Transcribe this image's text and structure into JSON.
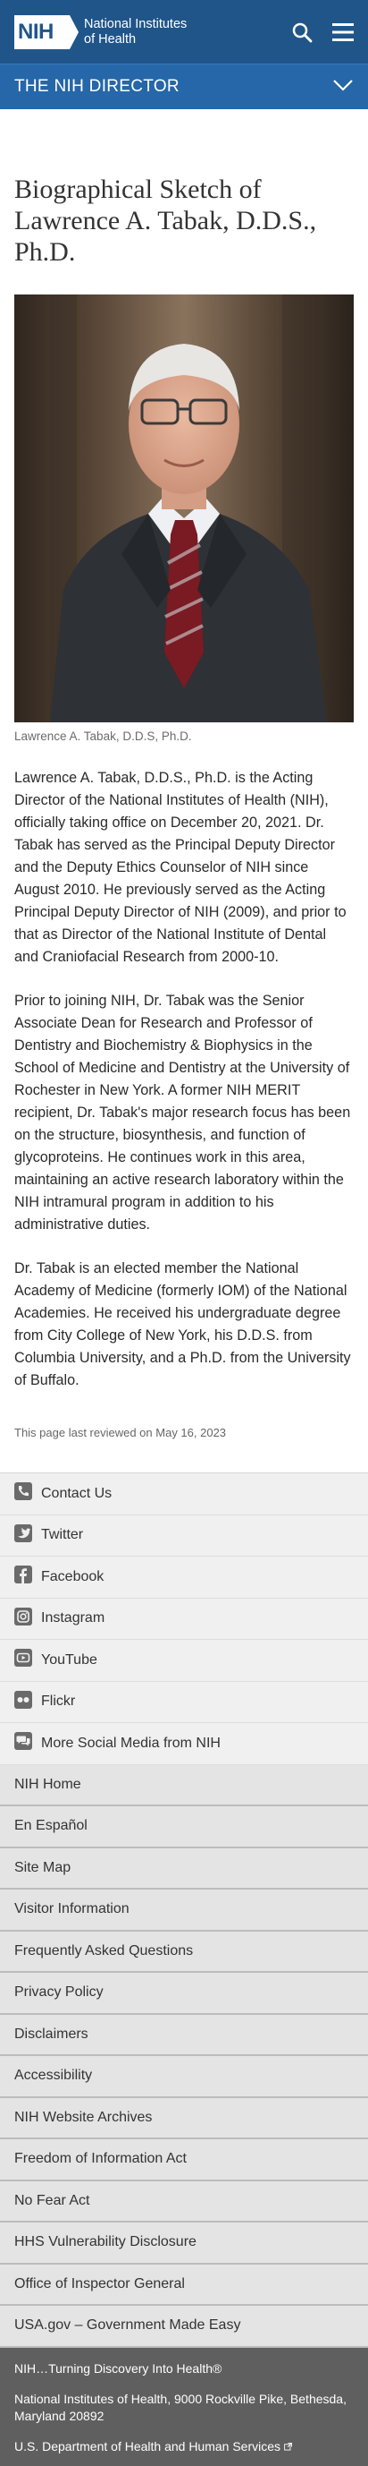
{
  "header": {
    "logo_mark": "NIH",
    "logo_line1": "National Institutes",
    "logo_line2": "of Health",
    "search_icon": "search-icon",
    "menu_icon": "hamburger-menu-icon"
  },
  "section_bar": {
    "title": "THE NIH DIRECTOR",
    "toggle_icon": "chevron-down-icon"
  },
  "article": {
    "title": "Biographical Sketch of Lawrence A. Tabak, D.D.S., Ph.D.",
    "image_caption": "Lawrence A. Tabak, D.D.S, Ph.D.",
    "paragraphs": [
      "Lawrence A. Tabak, D.D.S., Ph.D. is the Acting Director of the National Institutes of Health (NIH), officially taking office on December 20, 2021. Dr. Tabak has served as the Principal Deputy Director and the Deputy Ethics Counselor of NIH since August 2010. He previously served as the Acting Principal Deputy Director of NIH (2009), and prior to that as Director of the National Institute of Dental and Craniofacial Research from 2000-10.",
      "Prior to joining NIH, Dr. Tabak was the Senior Associate Dean for Research and Professor of Dentistry and Biochemistry & Biophysics in the School of Medicine and Dentistry at the University of Rochester in New York. A former NIH MERIT recipient, Dr. Tabak's major research focus has been on the structure, biosynthesis, and function of glycoproteins. He continues work in this area, maintaining an active research laboratory within the NIH intramural program in addition to his administrative duties.",
      "Dr. Tabak is an elected member the National Academy of Medicine (formerly IOM) of the National Academies. He received his undergraduate degree from City College of New York, his D.D.S. from Columbia University, and a Ph.D. from the University of Buffalo."
    ],
    "last_reviewed": "This page last reviewed on May 16, 2023"
  },
  "social": [
    {
      "label": "Contact Us",
      "icon": "phone-icon"
    },
    {
      "label": "Twitter",
      "icon": "twitter-icon"
    },
    {
      "label": "Facebook",
      "icon": "facebook-icon"
    },
    {
      "label": "Instagram",
      "icon": "instagram-icon"
    },
    {
      "label": "YouTube",
      "icon": "youtube-icon"
    },
    {
      "label": "Flickr",
      "icon": "flickr-icon"
    },
    {
      "label": "More Social Media from NIH",
      "icon": "chat-bubbles-icon"
    }
  ],
  "footer_links": [
    "NIH Home",
    "En Español",
    "Site Map",
    "Visitor Information",
    "Frequently Asked Questions",
    "Privacy Policy",
    "Disclaimers",
    "Accessibility",
    "NIH Website Archives",
    "Freedom of Information Act",
    "No Fear Act",
    "HHS Vulnerability Disclosure",
    "Office of Inspector General",
    "USA.gov – Government Made Easy"
  ],
  "bottom": {
    "tagline": "NIH…Turning Discovery Into Health®",
    "address": "National Institutes of Health, 9000 Rockville Pike, Bethesda, Maryland 20892",
    "hhs_link": "U.S. Department of Health and Human Services",
    "external_icon": "external-link-icon"
  },
  "colors": {
    "header_blue": "#20558a",
    "section_blue": "#2567a8",
    "footer_gray": "#5f5f5f"
  }
}
